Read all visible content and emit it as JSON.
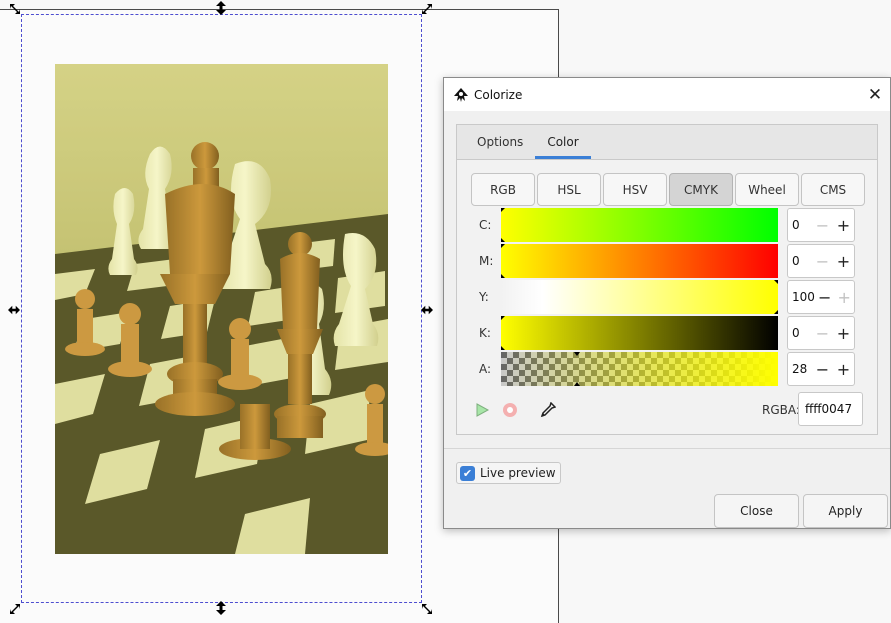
{
  "canvas": {
    "photo_alt": "chess-pieces-photo"
  },
  "dialog": {
    "title": "Colorize",
    "tabs": [
      {
        "label": "Options",
        "active": false
      },
      {
        "label": "Color",
        "active": true
      }
    ],
    "modes": [
      {
        "label": "RGB",
        "active": false
      },
      {
        "label": "HSL",
        "active": false
      },
      {
        "label": "HSV",
        "active": false
      },
      {
        "label": "CMYK",
        "active": true
      },
      {
        "label": "Wheel",
        "active": false
      },
      {
        "label": "CMS",
        "active": false
      }
    ],
    "sliders": [
      {
        "label": "C:",
        "value": "0"
      },
      {
        "label": "M:",
        "value": "0"
      },
      {
        "label": "Y:",
        "value": "100"
      },
      {
        "label": "K:",
        "value": "0"
      },
      {
        "label": "A:",
        "value": "28"
      }
    ],
    "rgba_label": "RGBA:",
    "rgba_value": "ffff0047",
    "live_preview_label": "Live preview",
    "live_preview_checked": true,
    "close_label": "Close",
    "apply_label": "Apply"
  },
  "colors": {
    "accent": "#3b7fd6",
    "selection": "#4d4dd0"
  }
}
